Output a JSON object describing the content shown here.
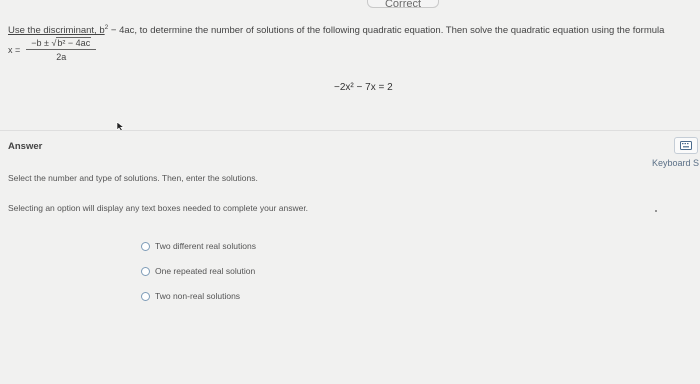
{
  "header": {
    "tab_label": "Correct"
  },
  "question": {
    "intro_before": "Use the discriminant, b",
    "intro_underlined": "Use the discriminant, b",
    "exp": "2",
    "intro_after": " − 4ac, to determine the number of solutions of the following quadratic equation. Then solve the quadratic equation using the formula",
    "formula_lhs": "x =",
    "formula_numerator_pre": "−b ± √",
    "formula_radicand": "b² − 4ac",
    "formula_denominator": "2a",
    "equation": "−2x² − 7x = 2"
  },
  "answer": {
    "label": "Answer",
    "instruction_1": "Select the number and type of solutions. Then, enter the solutions.",
    "instruction_2": "Selecting an option will display any text boxes needed to complete your answer.",
    "options": [
      "Two different real solutions",
      "One repeated real solution",
      "Two non-real solutions"
    ]
  },
  "keyboard": {
    "label": "Keyboard S",
    "icon": "keyboard-icon"
  }
}
